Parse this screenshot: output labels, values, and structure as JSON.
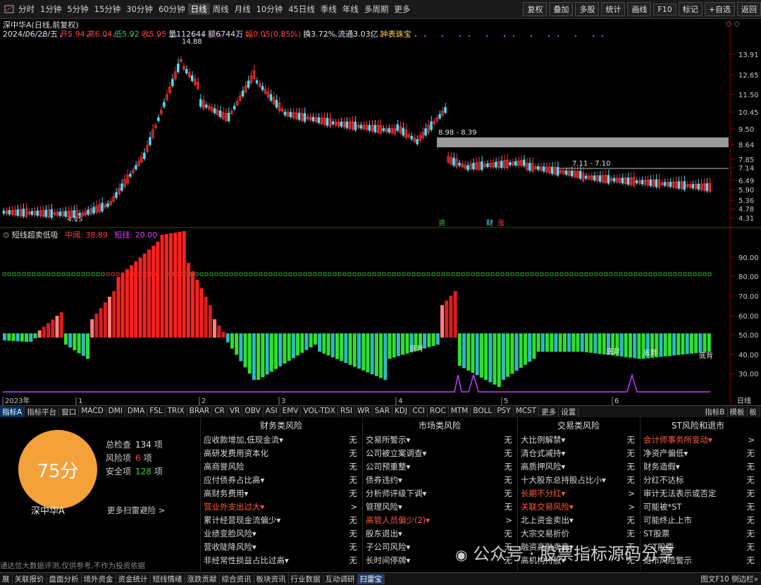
{
  "toolbar": {
    "periods": [
      "分时",
      "1分钟",
      "5分钟",
      "15分钟",
      "30分钟",
      "60分钟",
      "日线",
      "周线",
      "月线",
      "10分钟",
      "45日线",
      "季线",
      "年线",
      "多周期",
      "更多"
    ],
    "active_period": "日线",
    "tools": [
      "复权",
      "叠加",
      "多股",
      "统计",
      "画线",
      "F10",
      "标记",
      "+自选",
      "返回"
    ]
  },
  "kline": {
    "title": "深中华A(日线,前复权)",
    "info": {
      "date": "2024/06/28/五",
      "open": "开5.94",
      "high": "高6.04",
      "low": "低5.92",
      "close": "收5.95",
      "volume": "量112644",
      "amount": "额6744万",
      "change": "幅0.05(0.85%)",
      "turnover": "换3.72%",
      "float": "流通3.03亿",
      "tool": "钟表珠宝"
    },
    "y_ticks": [
      "13.91",
      "12.65",
      "11.50",
      "10.45",
      "9.50",
      "8.64",
      "7.85",
      "7.14",
      "6.49",
      "5.90",
      "5.36",
      "4.78",
      "4.31"
    ],
    "peak_label": "14.88",
    "low_label": "4.15",
    "zone1_label": "8.98 - 8.39",
    "zone2_label": "7.11 - 7.10",
    "event_tags": [
      "资",
      "财",
      "涨"
    ]
  },
  "indicator": {
    "name": "短线超卖低吸",
    "mid_label": "中阈: 38.89",
    "short_label": "短线: 20.00",
    "y_ticks": [
      "90.00",
      "80.00",
      "70.00",
      "60.00",
      "50.00",
      "40.00",
      "30.00"
    ],
    "bottom_labels": [
      "底背",
      "底背",
      "底背",
      "底背"
    ],
    "x_labels": [
      "2023年",
      "1",
      "2",
      "3",
      "4",
      "5",
      "6"
    ],
    "right_label": "日线"
  },
  "indicator_tabs": [
    "指标A",
    "指标平台",
    "窗口",
    "MACD",
    "DMI",
    "DMA",
    "FSL",
    "TRIX",
    "BRAR",
    "CR",
    "VR",
    "OBV",
    "ASI",
    "EMV",
    "VOL-TDX",
    "RSI",
    "WR",
    "SAR",
    "KDJ",
    "CCI",
    "ROC",
    "MTM",
    "BOLL",
    "PSY",
    "MCST",
    "更多",
    "设置"
  ],
  "indicator_tabs_right": [
    "指标B",
    "模板",
    "板"
  ],
  "risk": {
    "score": "75分",
    "stock_name": "深中华A",
    "stats": [
      {
        "label": "总检查",
        "value": "134",
        "unit": "项",
        "color": "#e0e0e0"
      },
      {
        "label": "风险项",
        "value": "6",
        "unit": "项",
        "color": "#ff4040"
      },
      {
        "label": "安全项",
        "value": "128",
        "unit": "项",
        "color": "#3ccf3c"
      }
    ],
    "more": "更多扫雷避险 >",
    "columns": [
      {
        "title": "财务类风险",
        "items": [
          {
            "k": "应收款增加,低现金流▾",
            "v": "无"
          },
          {
            "k": "高研发费用资本化",
            "v": "无"
          },
          {
            "k": "高商誉风险",
            "v": "无"
          },
          {
            "k": "应付债券占比高▾",
            "v": "无"
          },
          {
            "k": "高财务费用▾",
            "v": "无"
          },
          {
            "k": "营业外支出过大▾",
            "v": ">",
            "red": true
          },
          {
            "k": "累计经营现金流偏少▾",
            "v": "无"
          },
          {
            "k": "业绩变脸风险▾",
            "v": "无"
          },
          {
            "k": "营收陡降风险▾",
            "v": "无"
          },
          {
            "k": "非经常性损益占比过高▾",
            "v": "无"
          }
        ]
      },
      {
        "title": "市场类风险",
        "items": [
          {
            "k": "交易所警示▾",
            "v": "无"
          },
          {
            "k": "公司被立案调查▾",
            "v": "无"
          },
          {
            "k": "公司预重整▾",
            "v": "无"
          },
          {
            "k": "债券违约▾",
            "v": "无"
          },
          {
            "k": "分析师评级下调▾",
            "v": "无"
          },
          {
            "k": "管理风险▾",
            "v": "无"
          },
          {
            "k": "高管人员偏少(2)▾",
            "v": ">",
            "red": true
          },
          {
            "k": "股东退出▾",
            "v": "无"
          },
          {
            "k": "子公司风险▾",
            "v": "无"
          },
          {
            "k": "长时间停牌▾",
            "v": "无"
          }
        ]
      },
      {
        "title": "交易类风险",
        "items": [
          {
            "k": "大比例解禁▾",
            "v": "无"
          },
          {
            "k": "清仓式减持▾",
            "v": "无"
          },
          {
            "k": "高质押风险▾",
            "v": "无"
          },
          {
            "k": "十大股东总持股占比小▾",
            "v": "无"
          },
          {
            "k": "长期不分红▾",
            "v": ">",
            "red": true
          },
          {
            "k": "关联交易风险▾",
            "v": ">",
            "red": true
          },
          {
            "k": "北上资金卖出▾",
            "v": "无"
          },
          {
            "k": "大宗交易折价",
            "v": "无"
          },
          {
            "k": "融资高融卖高▾",
            "v": "无"
          },
          {
            "k": "高机构持股▾",
            "v": "无"
          }
        ]
      },
      {
        "title": "ST风险和退市",
        "items": [
          {
            "k": "会计师事务所变动▾",
            "v": ">",
            "red": true
          },
          {
            "k": "净资产偏低▾",
            "v": "无"
          },
          {
            "k": "财务造假▾",
            "v": "无"
          },
          {
            "k": "分红不达标",
            "v": "无"
          },
          {
            "k": "审计无法表示或否定",
            "v": "无"
          },
          {
            "k": "可能被*ST",
            "v": "无"
          },
          {
            "k": "可能终止上市",
            "v": "无"
          },
          {
            "k": "ST股票",
            "v": "无"
          },
          {
            "k": "*ST股票",
            "v": "无"
          },
          {
            "k": "退市风险警示",
            "v": "无"
          }
        ]
      }
    ],
    "disclaimer": "通达信大数据评测,仅供参考,不作为投资依据"
  },
  "bottom_tabs": [
    "展",
    "关联报价",
    "盘面分析",
    "境外资金",
    "资金统计",
    "短线情绪",
    "涨跌贡献",
    "综合资讯",
    "板块资讯",
    "行业数据",
    "互动调研",
    "扫雷宝"
  ],
  "bottom_right": "图文F10 侧边栏»",
  "watermark": "公众号 · 股票指标源码分享"
}
